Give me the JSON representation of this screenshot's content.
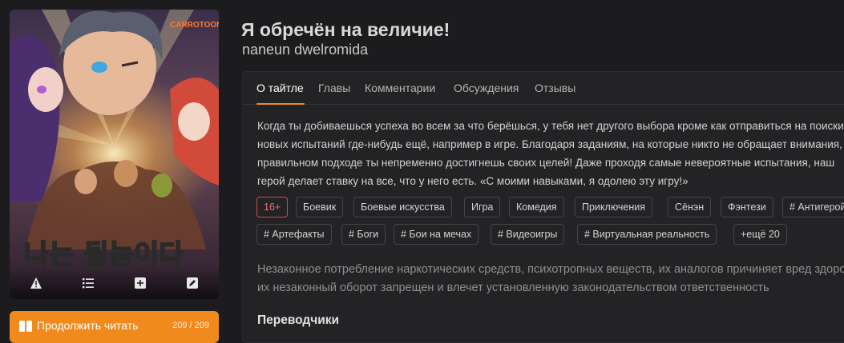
{
  "cover": {
    "logo": "CARROTOON",
    "title_art": "나는 될놈이다",
    "actions": [
      "warning-icon",
      "list-icon",
      "add-icon",
      "edit-icon"
    ]
  },
  "continue": {
    "label": "Продолжить читать",
    "progress": "209 / 209"
  },
  "title": "Я обречён на величие!",
  "subtitle": "naneun dwelromida",
  "tabs": [
    {
      "label": "О тайтле",
      "active": true
    },
    {
      "label": "Главы"
    },
    {
      "label": "Комментарии"
    },
    {
      "label": "Обсуждения"
    },
    {
      "label": "Отзывы"
    }
  ],
  "description": [
    "Когда ты добиваешься успеха во всем за что берёшься, у тебя нет другого выбора кроме как отправиться на поиски",
    "новых испытаний где-нибудь ещё, например в игре. Благодаря заданиям, на которые никто не обращает внимания, при",
    "правильном подходе ты непременно достигнешь своих целей! Даже проходя самые невероятные испытания, наш",
    "герой делает ставку на все, что у него есть. «С моими навыками, я одолею эту игру!»"
  ],
  "tags_row1": [
    "16+",
    "Боевик",
    "Боевые искусства",
    "Игра",
    "Комедия",
    "Приключения",
    "Сёнэн",
    "Фэнтези",
    "# Антигерой"
  ],
  "tags_row2": [
    "# Артефакты",
    "# Боги",
    "# Бои на мечах",
    "# Видеоигры",
    "# Виртуальная реальность",
    "+ещё 20"
  ],
  "disclaimer": [
    "Незаконное потребление наркотических средств, психотропных веществ, их аналогов причиняет вред здоровью,",
    "их незаконный оборот запрещен и влечет установленную законодательством ответственность"
  ],
  "translators_heading": "Переводчики",
  "colors": {
    "accent": "#f08a1c",
    "background": "#1c1c1e",
    "panel": "#232325",
    "age_tag": "#d04a4a"
  }
}
